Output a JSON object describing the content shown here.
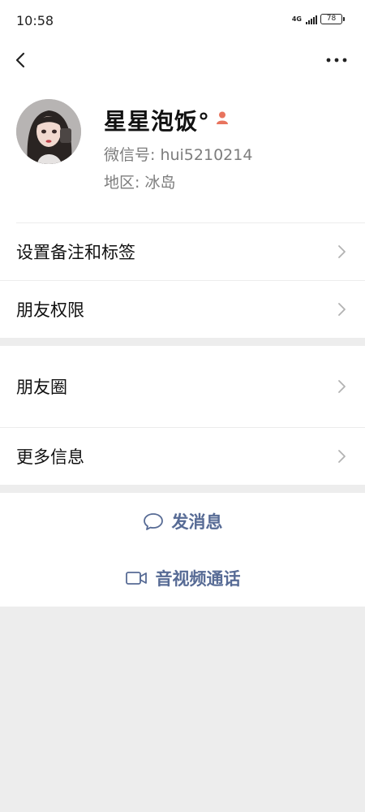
{
  "status_bar": {
    "time": "10:58",
    "network": "4G",
    "battery": "78"
  },
  "nav": {
    "back_icon": "chevron-left-icon",
    "more_icon": "more-dots-icon"
  },
  "profile": {
    "nickname": "星星泡饭°",
    "wechat_id": "微信号: hui5210214",
    "region": "地区: 冰岛",
    "gender_icon_color": "#e8745e"
  },
  "menu": {
    "remark_tags": "设置备注和标签",
    "friend_permissions": "朋友权限",
    "moments": "朋友圈",
    "more_info": "更多信息"
  },
  "actions": {
    "send_message": "发消息",
    "video_call": "音视频通话",
    "accent_color": "#576b95"
  }
}
